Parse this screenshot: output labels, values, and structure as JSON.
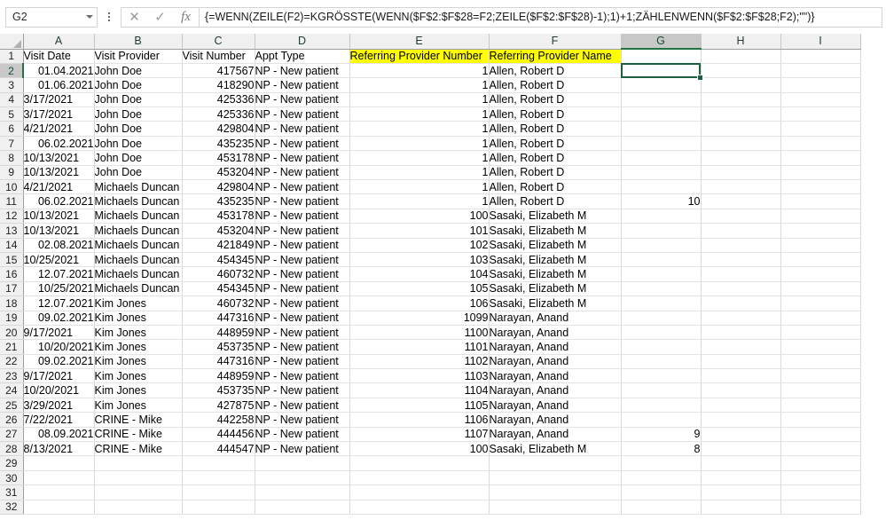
{
  "app": {
    "name_box_value": "G2",
    "name_box_icon": "chevron-down-icon",
    "kebab_icon": "more-options-icon",
    "cancel_icon": "cancel-formula-icon",
    "cancel_glyph": "✕",
    "confirm_icon": "confirm-formula-icon",
    "confirm_glyph": "✓",
    "fx_icon": "insert-function-icon",
    "fx_glyph": "fx",
    "formula": "{=WENN(ZEILE(F2)=KGRÖSSTE(WENN($F$2:$F$28=F2;ZEILE($F$2:$F$28)-1);1)+1;ZÄHLENWENN($F$2:$F$28;F2);\"\")}",
    "accent_color": "#217346",
    "highlight_color": "#ffff00",
    "active_cell": "G2",
    "active_column": "G",
    "active_row": "2"
  },
  "grid": {
    "columns": [
      {
        "letter": "A",
        "width": 80
      },
      {
        "letter": "B",
        "width": 99
      },
      {
        "letter": "C",
        "width": 82
      },
      {
        "letter": "D",
        "width": 107
      },
      {
        "letter": "E",
        "width": 157
      },
      {
        "letter": "F",
        "width": 149
      },
      {
        "letter": "G",
        "width": 90
      },
      {
        "letter": "H",
        "width": 90
      },
      {
        "letter": "I",
        "width": 90
      }
    ],
    "row_numbers": [
      1,
      2,
      3,
      4,
      5,
      6,
      7,
      8,
      9,
      10,
      11,
      12,
      13,
      14,
      15,
      16,
      17,
      18,
      19,
      20,
      21,
      22,
      23,
      24,
      25,
      26,
      27,
      28,
      29,
      30,
      31,
      32
    ],
    "headers": {
      "A": "Visit Date",
      "B": "Visit Provider",
      "C": "Visit Number",
      "D": "Appt Type",
      "E": "Referring Provider Number",
      "F": "Referring Provider Name",
      "G": "",
      "H": "",
      "I": ""
    },
    "highlighted_header_columns": [
      "E",
      "F"
    ],
    "rows": [
      {
        "n": 2,
        "A": "01.04.2021",
        "A_align": "r",
        "B": "John Doe",
        "C": "417567",
        "D": "NP - New patient",
        "E": "1",
        "F": "Allen, Robert D",
        "G": ""
      },
      {
        "n": 3,
        "A": "01.06.2021",
        "A_align": "r",
        "B": "John Doe",
        "C": "418290",
        "D": "NP - New patient",
        "E": "1",
        "F": "Allen, Robert D",
        "G": ""
      },
      {
        "n": 4,
        "A": "3/17/2021",
        "A_align": "l",
        "B": "John Doe",
        "C": "425336",
        "D": "NP - New patient",
        "E": "1",
        "F": "Allen, Robert D",
        "G": ""
      },
      {
        "n": 5,
        "A": "3/17/2021",
        "A_align": "l",
        "B": "John Doe",
        "C": "425336",
        "D": "NP - New patient",
        "E": "1",
        "F": "Allen, Robert D",
        "G": ""
      },
      {
        "n": 6,
        "A": "4/21/2021",
        "A_align": "l",
        "B": "John Doe",
        "C": "429804",
        "D": "NP - New patient",
        "E": "1",
        "F": "Allen, Robert D",
        "G": ""
      },
      {
        "n": 7,
        "A": "06.02.2021",
        "A_align": "r",
        "B": "John Doe",
        "C": "435235",
        "D": "NP - New patient",
        "E": "1",
        "F": "Allen, Robert D",
        "G": ""
      },
      {
        "n": 8,
        "A": "10/13/2021",
        "A_align": "l",
        "B": "John Doe",
        "C": "453178",
        "D": "NP - New patient",
        "E": "1",
        "F": "Allen, Robert D",
        "G": ""
      },
      {
        "n": 9,
        "A": "10/13/2021",
        "A_align": "l",
        "B": "John Doe",
        "C": "453204",
        "D": "NP - New patient",
        "E": "1",
        "F": "Allen, Robert D",
        "G": ""
      },
      {
        "n": 10,
        "A": "4/21/2021",
        "A_align": "l",
        "B": "Michaels Duncan",
        "C": "429804",
        "D": "NP - New patient",
        "E": "1",
        "F": "Allen, Robert D",
        "G": ""
      },
      {
        "n": 11,
        "A": "06.02.2021",
        "A_align": "r",
        "B": "Michaels Duncan",
        "C": "435235",
        "D": "NP - New patient",
        "E": "1",
        "F": "Allen, Robert D",
        "G": "10"
      },
      {
        "n": 12,
        "A": "10/13/2021",
        "A_align": "l",
        "B": "Michaels Duncan",
        "C": "453178",
        "D": "NP - New patient",
        "E": "100",
        "F": "Sasaki, Elizabeth M",
        "G": ""
      },
      {
        "n": 13,
        "A": "10/13/2021",
        "A_align": "l",
        "B": "Michaels Duncan",
        "C": "453204",
        "D": "NP - New patient",
        "E": "101",
        "F": "Sasaki, Elizabeth M",
        "G": ""
      },
      {
        "n": 14,
        "A": "02.08.2021",
        "A_align": "r",
        "B": "Michaels Duncan",
        "C": "421849",
        "D": "NP - New patient",
        "E": "102",
        "F": "Sasaki, Elizabeth M",
        "G": ""
      },
      {
        "n": 15,
        "A": "10/25/2021",
        "A_align": "l",
        "B": "Michaels Duncan",
        "C": "454345",
        "D": "NP - New patient",
        "E": "103",
        "F": "Sasaki, Elizabeth M",
        "G": ""
      },
      {
        "n": 16,
        "A": "12.07.2021",
        "A_align": "r",
        "B": "Michaels Duncan",
        "C": "460732",
        "D": "NP - New patient",
        "E": "104",
        "F": "Sasaki, Elizabeth M",
        "G": ""
      },
      {
        "n": 17,
        "A": "10/25/2021",
        "A_align": "r",
        "B": "Michaels Duncan",
        "C": "454345",
        "D": "NP - New patient",
        "E": "105",
        "F": "Sasaki, Elizabeth M",
        "G": ""
      },
      {
        "n": 18,
        "A": "12.07.2021",
        "A_align": "r",
        "B": "Kim Jones",
        "C": "460732",
        "D": "NP - New patient",
        "E": "106",
        "F": "Sasaki, Elizabeth M",
        "G": ""
      },
      {
        "n": 19,
        "A": "09.02.2021",
        "A_align": "r",
        "B": "Kim Jones",
        "C": "447316",
        "D": "NP - New patient",
        "E": "1099",
        "F": "Narayan, Anand",
        "G": ""
      },
      {
        "n": 20,
        "A": "9/17/2021",
        "A_align": "l",
        "B": "Kim Jones",
        "C": "448959",
        "D": "NP - New patient",
        "E": "1100",
        "F": "Narayan, Anand",
        "G": ""
      },
      {
        "n": 21,
        "A": "10/20/2021",
        "A_align": "r",
        "B": "Kim Jones",
        "C": "453735",
        "D": "NP - New patient",
        "E": "1101",
        "F": "Narayan, Anand",
        "G": ""
      },
      {
        "n": 22,
        "A": "09.02.2021",
        "A_align": "r",
        "B": "Kim Jones",
        "C": "447316",
        "D": "NP - New patient",
        "E": "1102",
        "F": "Narayan, Anand",
        "G": ""
      },
      {
        "n": 23,
        "A": "9/17/2021",
        "A_align": "l",
        "B": "Kim Jones",
        "C": "448959",
        "D": "NP - New patient",
        "E": "1103",
        "F": "Narayan, Anand",
        "G": ""
      },
      {
        "n": 24,
        "A": "10/20/2021",
        "A_align": "l",
        "B": "Kim Jones",
        "C": "453735",
        "D": "NP - New patient",
        "E": "1104",
        "F": "Narayan, Anand",
        "G": ""
      },
      {
        "n": 25,
        "A": "3/29/2021",
        "A_align": "l",
        "B": "Kim Jones",
        "C": "427875",
        "D": "NP - New patient",
        "E": "1105",
        "F": "Narayan, Anand",
        "G": ""
      },
      {
        "n": 26,
        "A": "7/22/2021",
        "A_align": "l",
        "B": "CRINE - Mike",
        "C": "442258",
        "D": "NP - New patient",
        "E": "1106",
        "F": "Narayan, Anand",
        "G": ""
      },
      {
        "n": 27,
        "A": "08.09.2021",
        "A_align": "r",
        "B": "CRINE - Mike",
        "C": "444456",
        "D": "NP - New patient",
        "E": "1107",
        "F": "Narayan, Anand",
        "G": "9"
      },
      {
        "n": 28,
        "A": "8/13/2021",
        "A_align": "l",
        "B": "CRINE - Mike",
        "C": "444547",
        "D": "NP - New patient",
        "E": "100",
        "F": "Sasaki, Elizabeth M",
        "G": "8"
      },
      {
        "n": 29,
        "A": "",
        "A_align": "l",
        "B": "",
        "C": "",
        "D": "",
        "E": "",
        "F": "",
        "G": ""
      },
      {
        "n": 30,
        "A": "",
        "A_align": "l",
        "B": "",
        "C": "",
        "D": "",
        "E": "",
        "F": "",
        "G": ""
      },
      {
        "n": 31,
        "A": "",
        "A_align": "l",
        "B": "",
        "C": "",
        "D": "",
        "E": "",
        "F": "",
        "G": ""
      },
      {
        "n": 32,
        "A": "",
        "A_align": "l",
        "B": "",
        "C": "",
        "D": "",
        "E": "",
        "F": "",
        "G": ""
      }
    ]
  }
}
